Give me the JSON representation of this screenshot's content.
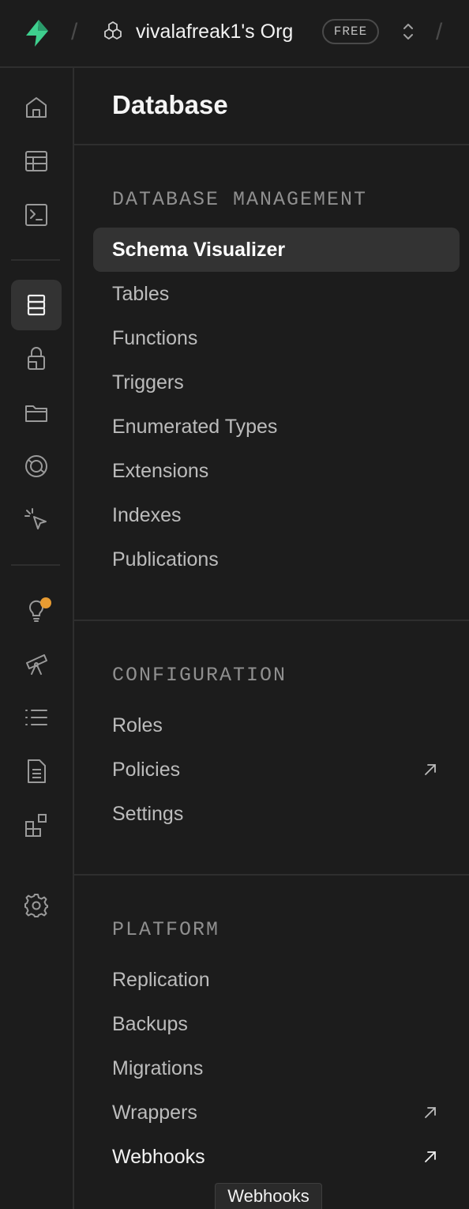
{
  "header": {
    "org_name": "vivalafreak1's Org",
    "plan_badge": "FREE",
    "separator": "/"
  },
  "sidebar_icons": [
    "home-icon",
    "table-editor-icon",
    "sql-editor-icon",
    "database-icon",
    "auth-lock-icon",
    "storage-folder-icon",
    "realtime-icon",
    "edge-functions-cursor-icon",
    "advisors-lightbulb-icon",
    "observability-telescope-icon",
    "logs-list-icon",
    "docs-file-icon",
    "integrations-icon",
    "settings-gear-icon"
  ],
  "panel": {
    "title": "Database",
    "sections": [
      {
        "label": "DATABASE MANAGEMENT",
        "items": [
          {
            "label": "Schema Visualizer",
            "active": true
          },
          {
            "label": "Tables"
          },
          {
            "label": "Functions"
          },
          {
            "label": "Triggers"
          },
          {
            "label": "Enumerated Types"
          },
          {
            "label": "Extensions"
          },
          {
            "label": "Indexes"
          },
          {
            "label": "Publications"
          }
        ]
      },
      {
        "label": "CONFIGURATION",
        "items": [
          {
            "label": "Roles"
          },
          {
            "label": "Policies",
            "external": true
          },
          {
            "label": "Settings"
          }
        ]
      },
      {
        "label": "PLATFORM",
        "items": [
          {
            "label": "Replication"
          },
          {
            "label": "Backups"
          },
          {
            "label": "Migrations"
          },
          {
            "label": "Wrappers",
            "external": true
          },
          {
            "label": "Webhooks",
            "external": true,
            "hovered": true
          }
        ]
      }
    ]
  },
  "tooltip": "Webhooks",
  "colors": {
    "background": "#1c1c1c",
    "brand_green": "#3ecf8e",
    "active_bg": "#333333",
    "notification_dot": "#e79b32"
  }
}
